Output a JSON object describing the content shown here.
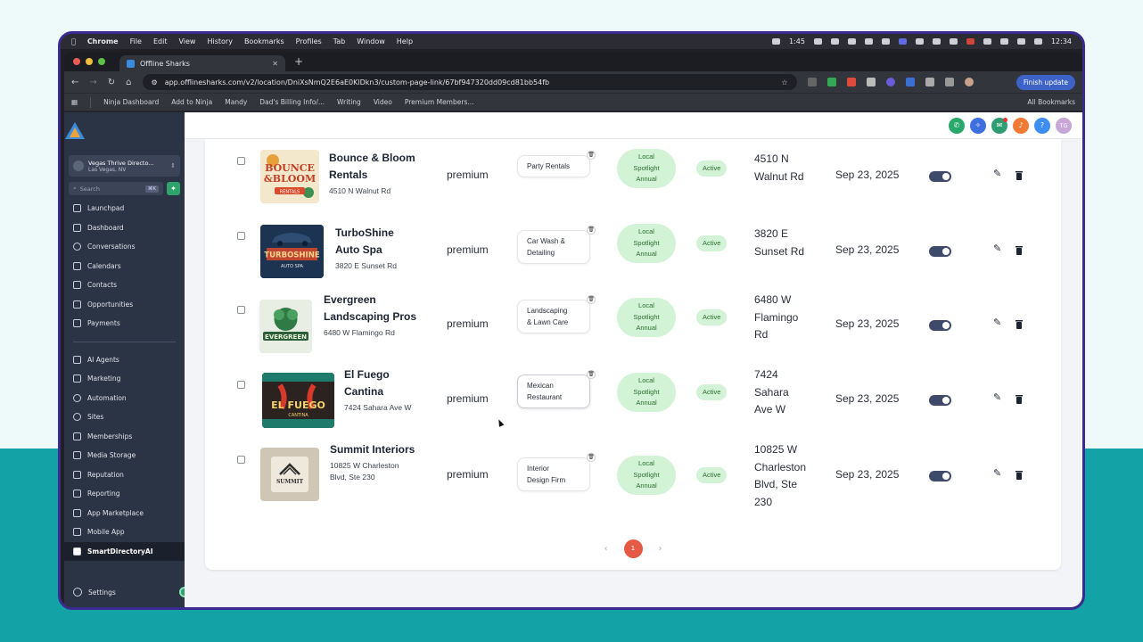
{
  "macos_menu": {
    "items": [
      "Chrome",
      "File",
      "Edit",
      "View",
      "History",
      "Bookmarks",
      "Profiles",
      "Tab",
      "Window",
      "Help"
    ],
    "timer": "1:45",
    "clock": "12:34"
  },
  "browser": {
    "tab_title": "Offline Sharks",
    "url": "app.offlinesharks.com/v2/location/DniXsNmQ2E6aE0KlDkn3/custom-page-link/67bf947320dd09cd81bb54fb",
    "finish_update": "Finish update",
    "bookmarks": [
      "Ninja Dashboard",
      "Add to Ninja",
      "Mandy",
      "Dad's Billing Info/...",
      "Writing",
      "Video",
      "Premium Members..."
    ],
    "all_bookmarks": "All Bookmarks"
  },
  "sidebar": {
    "location_name": "Vegas Thrive Directo...",
    "location_city": "Las Vegas, NV",
    "search_placeholder": "Search",
    "search_shortcut": "⌘K",
    "nav_primary": [
      {
        "label": "Launchpad"
      },
      {
        "label": "Dashboard"
      },
      {
        "label": "Conversations"
      },
      {
        "label": "Calendars"
      },
      {
        "label": "Contacts"
      },
      {
        "label": "Opportunities"
      },
      {
        "label": "Payments"
      }
    ],
    "nav_secondary": [
      {
        "label": "AI Agents"
      },
      {
        "label": "Marketing"
      },
      {
        "label": "Automation"
      },
      {
        "label": "Sites"
      },
      {
        "label": "Memberships"
      },
      {
        "label": "Media Storage"
      },
      {
        "label": "Reputation"
      },
      {
        "label": "Reporting"
      },
      {
        "label": "App Marketplace"
      },
      {
        "label": "Mobile App"
      },
      {
        "label": "SmartDirectoryAI"
      }
    ],
    "settings": "Settings"
  },
  "topbar": {
    "avatar_initials": "TG"
  },
  "listings": [
    {
      "name_lines": [
        "Bounce & Bloom",
        "Rentals"
      ],
      "address": "4510 N Walnut Rd",
      "plan": "premium",
      "category_lines": [
        "Party Rentals"
      ],
      "spotlight_lines": [
        "Local",
        "Spotlight",
        "Annual"
      ],
      "status": "Active",
      "location_lines": [
        "4510 N",
        "Walnut Rd"
      ],
      "date": "Sep 23, 2025"
    },
    {
      "name_lines": [
        "TurboShine",
        "Auto Spa"
      ],
      "address": "3820 E Sunset Rd",
      "plan": "premium",
      "category_lines": [
        "Car Wash &",
        "Detailing"
      ],
      "spotlight_lines": [
        "Local",
        "Spotlight",
        "Annual"
      ],
      "status": "Active",
      "location_lines": [
        "3820 E",
        "Sunset Rd"
      ],
      "date": "Sep 23, 2025"
    },
    {
      "name_lines": [
        "Evergreen",
        "Landscaping Pros"
      ],
      "address": "6480 W Flamingo Rd",
      "plan": "premium",
      "category_lines": [
        "Landscaping",
        "& Lawn Care"
      ],
      "spotlight_lines": [
        "Local",
        "Spotlight",
        "Annual"
      ],
      "status": "Active",
      "location_lines": [
        "6480 W",
        "Flamingo",
        "Rd"
      ],
      "date": "Sep 23, 2025"
    },
    {
      "name_lines": [
        "El Fuego",
        "Cantina"
      ],
      "address": "7424 Sahara Ave W",
      "plan": "premium",
      "category_lines": [
        "Mexican",
        "Restaurant"
      ],
      "spotlight_lines": [
        "Local",
        "Spotlight",
        "Annual"
      ],
      "status": "Active",
      "location_lines": [
        "7424",
        "Sahara",
        "Ave W"
      ],
      "date": "Sep 23, 2025"
    },
    {
      "name_lines": [
        "Summit Interiors"
      ],
      "address_lines": [
        "10825 W Charleston",
        "Blvd, Ste 230"
      ],
      "plan": "premium",
      "category_lines": [
        "Interior",
        "Design Firm"
      ],
      "spotlight_lines": [
        "Local",
        "Spotlight",
        "Annual"
      ],
      "status": "Active",
      "location_lines": [
        "10825 W",
        "Charleston",
        "Blvd, Ste",
        "230"
      ],
      "date": "Sep 23, 2025"
    }
  ],
  "pagination": {
    "prev": "‹",
    "current": "1",
    "next": "›"
  },
  "logo_texts": {
    "bounce": [
      "BOUNCE",
      "&BLOOM",
      "RENTALS"
    ],
    "turbo": [
      "TURBOSHINE",
      "AUTO SPA"
    ],
    "evergreen": "EVERGREEN",
    "fuego": [
      "EL FUEGO",
      "CANTINA"
    ],
    "summit": "SUMMIT"
  },
  "colors": {
    "accent": "#e45a45",
    "status_bg": "#d2f3d5",
    "status_text": "#2c6e2f",
    "sidebar_bg": "#2b3445"
  }
}
